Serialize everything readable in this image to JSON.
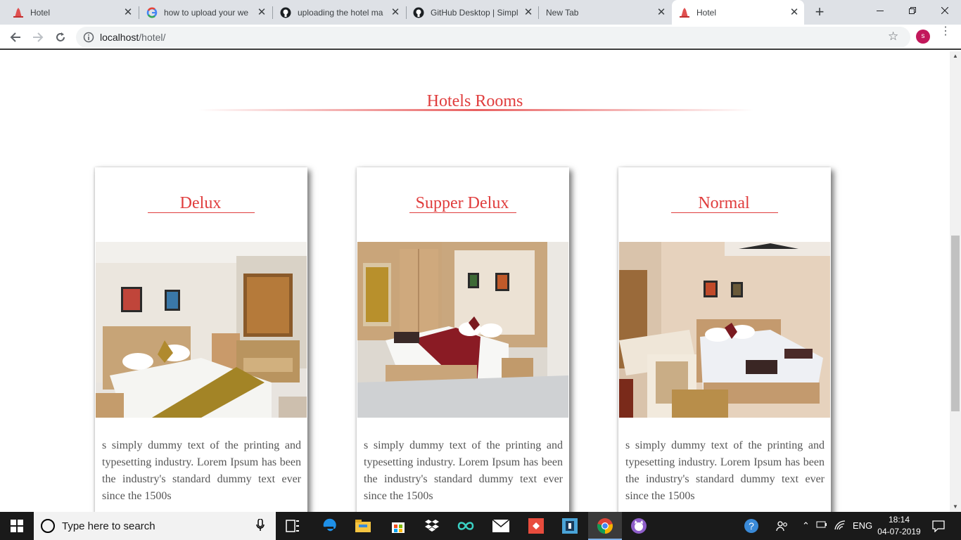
{
  "browser": {
    "tabs": [
      {
        "title": "Hotel",
        "icon": "hotel-favicon"
      },
      {
        "title": "how to upload your we",
        "icon": "google-icon"
      },
      {
        "title": "uploading the hotel ma",
        "icon": "github-icon"
      },
      {
        "title": "GitHub Desktop | Simpl",
        "icon": "github-icon"
      },
      {
        "title": "New Tab",
        "icon": ""
      },
      {
        "title": "Hotel",
        "icon": "hotel-favicon",
        "active": true
      }
    ],
    "url_host": "localhost",
    "url_path": "/hotel/",
    "profile_initial": "s"
  },
  "page": {
    "section_title": "Hotels Rooms",
    "rooms": [
      {
        "name": "Delux",
        "description": "s simply dummy text of the printing and typesetting industry. Lorem Ipsum has been the industry's standard dummy text ever since the 1500s"
      },
      {
        "name": "Supper Delux",
        "description": "s simply dummy text of the printing and typesetting industry. Lorem Ipsum has been the industry's standard dummy text ever since the 1500s"
      },
      {
        "name": "Normal",
        "description": "s simply dummy text of the printing and typesetting industry. Lorem Ipsum has been the industry's standard dummy text ever since the 1500s"
      }
    ],
    "accent_color": "#e03d3d"
  },
  "taskbar": {
    "search_placeholder": "Type here to search",
    "language": "ENG",
    "time": "18:14",
    "date": "04-07-2019"
  }
}
